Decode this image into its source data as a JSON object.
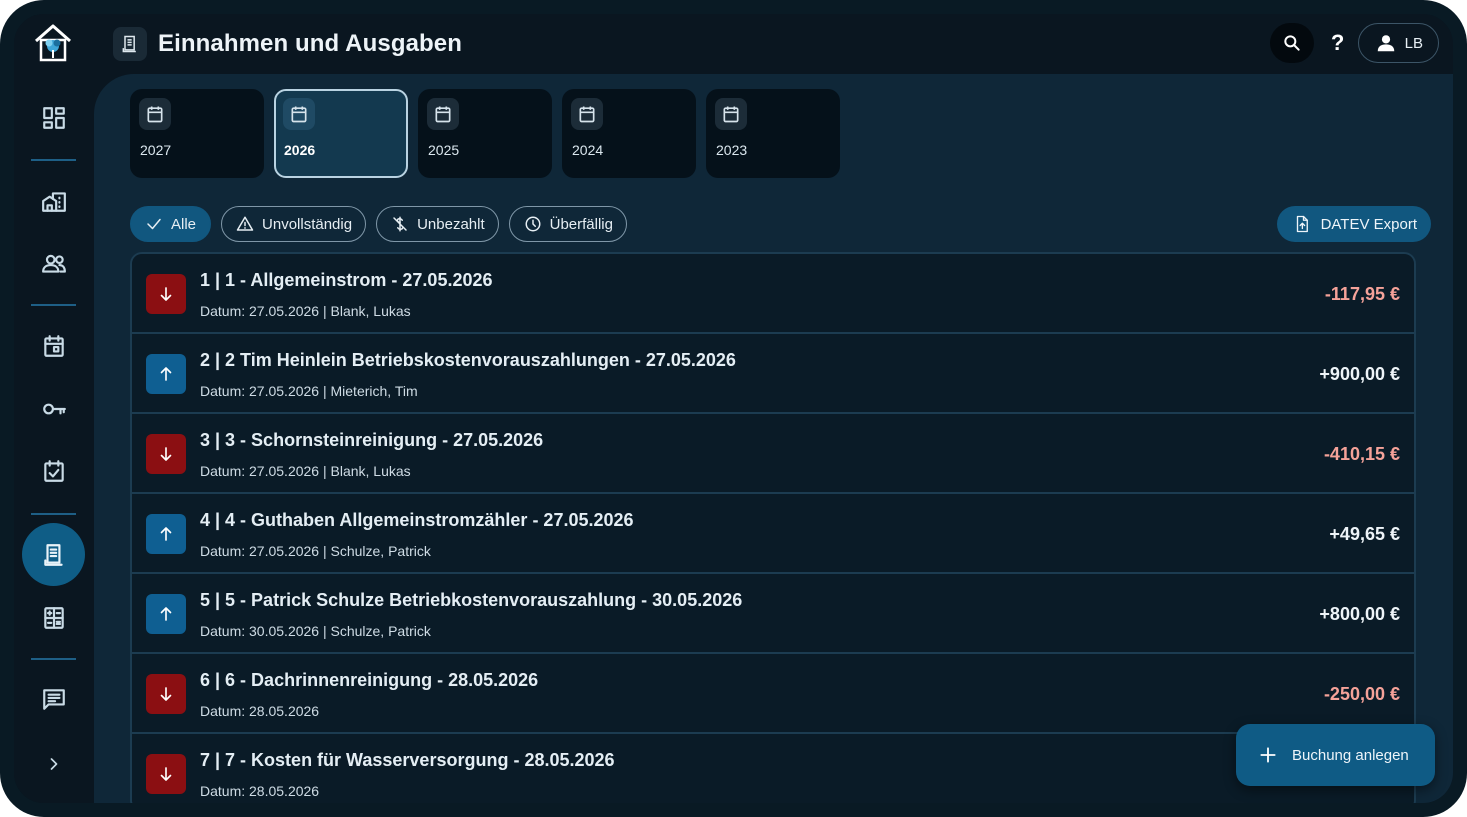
{
  "header": {
    "title": "Einnahmen und Ausgaben",
    "help_label": "?",
    "user_initials": "LB"
  },
  "sidebar": {
    "items": [
      {
        "icon": "dashboard-icon",
        "name": "Dashboard"
      },
      {
        "icon": "building-icon",
        "name": "Objekte"
      },
      {
        "icon": "people-icon",
        "name": "Mieter"
      },
      {
        "icon": "calendar-icon",
        "name": "Kalender"
      },
      {
        "icon": "key-icon",
        "name": "Schlüssel"
      },
      {
        "icon": "task-icon",
        "name": "Aufgaben"
      },
      {
        "icon": "receipt-icon",
        "name": "Einnahmen und Ausgaben",
        "active": true
      },
      {
        "icon": "calculator-icon",
        "name": "Abrechnung"
      },
      {
        "icon": "chat-icon",
        "name": "Nachrichten"
      },
      {
        "icon": "chevron-right-icon",
        "name": "Ausklappen"
      }
    ]
  },
  "years": [
    {
      "label": "2027",
      "active": false
    },
    {
      "label": "2026",
      "active": true
    },
    {
      "label": "2025",
      "active": false
    },
    {
      "label": "2024",
      "active": false
    },
    {
      "label": "2023",
      "active": false
    }
  ],
  "filters": {
    "all": "Alle",
    "incomplete": "Unvollständig",
    "unpaid": "Unbezahlt",
    "overdue": "Überfällig",
    "active": "all"
  },
  "datev_label": "DATEV Export",
  "bookings": [
    {
      "direction": "out",
      "title": "1 | 1 - Allgemeinstrom - 27.05.2026",
      "subtitle": "Datum: 27.05.2026 | Blank, Lukas",
      "amount": "-117,95 €"
    },
    {
      "direction": "in",
      "title": "2 | 2 Tim Heinlein Betriebskostenvorauszahlungen - 27.05.2026",
      "subtitle": "Datum: 27.05.2026 | Mieterich, Tim",
      "amount": "+900,00 €"
    },
    {
      "direction": "out",
      "title": "3 | 3 - Schornsteinreinigung - 27.05.2026",
      "subtitle": "Datum: 27.05.2026 | Blank, Lukas",
      "amount": "-410,15 €"
    },
    {
      "direction": "in",
      "title": "4 | 4 - Guthaben Allgemeinstromzähler - 27.05.2026",
      "subtitle": "Datum: 27.05.2026 | Schulze, Patrick",
      "amount": "+49,65 €"
    },
    {
      "direction": "in",
      "title": "5 | 5 - Patrick Schulze Betriebkostenvorauszahlung - 30.05.2026",
      "subtitle": "Datum: 30.05.2026 | Schulze, Patrick",
      "amount": "+800,00 €"
    },
    {
      "direction": "out",
      "title": "6 | 6 - Dachrinnenreinigung  - 28.05.2026",
      "subtitle": "Datum: 28.05.2026",
      "amount": "-250,00 €"
    },
    {
      "direction": "out",
      "title": "7 | 7 - Kosten für Wasserversorgung - 28.05.2026",
      "subtitle": "Datum: 28.05.2026",
      "amount": ""
    }
  ],
  "fab_label": "Buchung anlegen",
  "colors": {
    "accent": "#11577f",
    "expense": "#8b0f12",
    "income": "#0f5f92",
    "negative_amount": "#f5a299"
  }
}
